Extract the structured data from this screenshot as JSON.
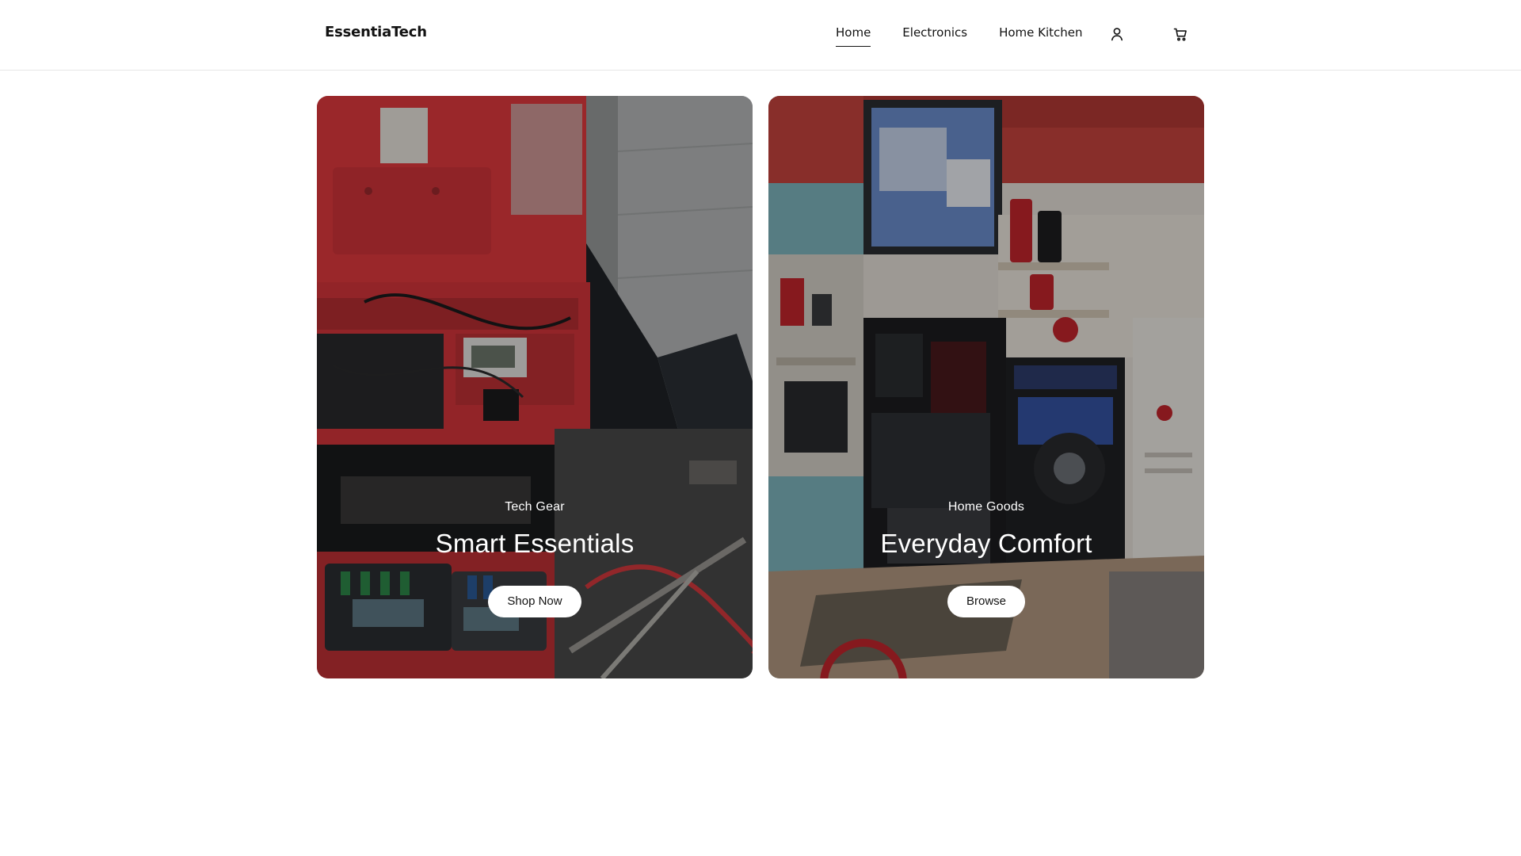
{
  "header": {
    "logo": "EssentiaTech",
    "nav": [
      {
        "label": "Home",
        "active": true
      },
      {
        "label": "Electronics",
        "active": false
      },
      {
        "label": "Home Kitchen",
        "active": false
      }
    ],
    "icons": [
      "account-icon",
      "cart-icon"
    ]
  },
  "cards": [
    {
      "eyebrow": "Tech Gear",
      "title": "Smart Essentials",
      "button": "Shop Now",
      "image": "electronics-toolbox-photo"
    },
    {
      "eyebrow": "Home Goods",
      "title": "Everyday Comfort",
      "button": "Browse",
      "image": "appliance-store-photo"
    }
  ],
  "colors": {
    "text": "#121212",
    "background": "#ffffff",
    "border": "#e6e6e6",
    "button_bg": "#ffffff"
  }
}
